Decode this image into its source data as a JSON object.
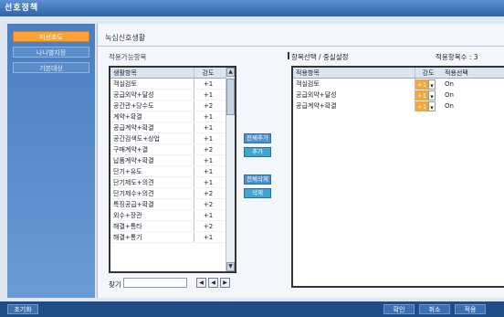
{
  "window": {
    "title": "선호정책"
  },
  "sidebar": {
    "items": [
      {
        "label": "미선호도",
        "active": true
      },
      {
        "label": "나니별지정",
        "active": false
      },
      {
        "label": "기본대상",
        "active": false
      }
    ]
  },
  "main": {
    "section_title": "녹십신호생활",
    "left_caption": "적용가능항목",
    "list": {
      "headers": [
        "생활항목",
        "강도"
      ],
      "rows": [
        [
          "객실검토",
          "+1"
        ],
        [
          "공급외약+달성",
          "+1"
        ],
        [
          "공간관+당수도",
          "+2"
        ],
        [
          "계약+확결",
          "+1"
        ],
        [
          "공급계약+확결",
          "+1"
        ],
        [
          "공간검색도+상업",
          "+1"
        ],
        [
          "구매계약+결",
          "+2"
        ],
        [
          "납품계약+확결",
          "+1"
        ],
        [
          "단기+유도",
          "+1"
        ],
        [
          "단기제도+의견",
          "+1"
        ],
        [
          "단기제수+의견",
          "+2"
        ],
        [
          "특징공급+확결",
          "+2"
        ],
        [
          "외수+장관",
          "+1"
        ],
        [
          "해결+통타",
          "+2"
        ],
        [
          "해결+통기",
          "+1"
        ]
      ]
    },
    "search": {
      "label": "찾기",
      "value": ""
    },
    "nav": [
      "◀",
      "◀",
      "▶"
    ],
    "middle_buttons": [
      {
        "label": "전체추가",
        "style": "blue"
      },
      {
        "label": "추가",
        "style": "cyan"
      },
      {
        "label": "전체삭제",
        "style": "blue"
      },
      {
        "label": "삭제",
        "style": "cyan"
      }
    ],
    "right_caption": "항목선택 / 중실설정",
    "count_label": "적용항목수 : 3",
    "selected": {
      "headers": [
        "적용항목",
        "강도",
        "적용선택"
      ],
      "rows": [
        {
          "name": "객실검토",
          "weight": "+1",
          "option": "On"
        },
        {
          "name": "공급외약+달성",
          "weight": "+1",
          "option": "On"
        },
        {
          "name": "공급계약+확결",
          "weight": "+1",
          "option": "On"
        }
      ]
    }
  },
  "bottom": {
    "left_button": "초기화",
    "right_buttons": [
      "확인",
      "취소",
      "적용"
    ]
  },
  "colors": {
    "accent": "#f6a43b",
    "titlebar": "#2f63a8",
    "bottombar": "#1f4e86"
  }
}
